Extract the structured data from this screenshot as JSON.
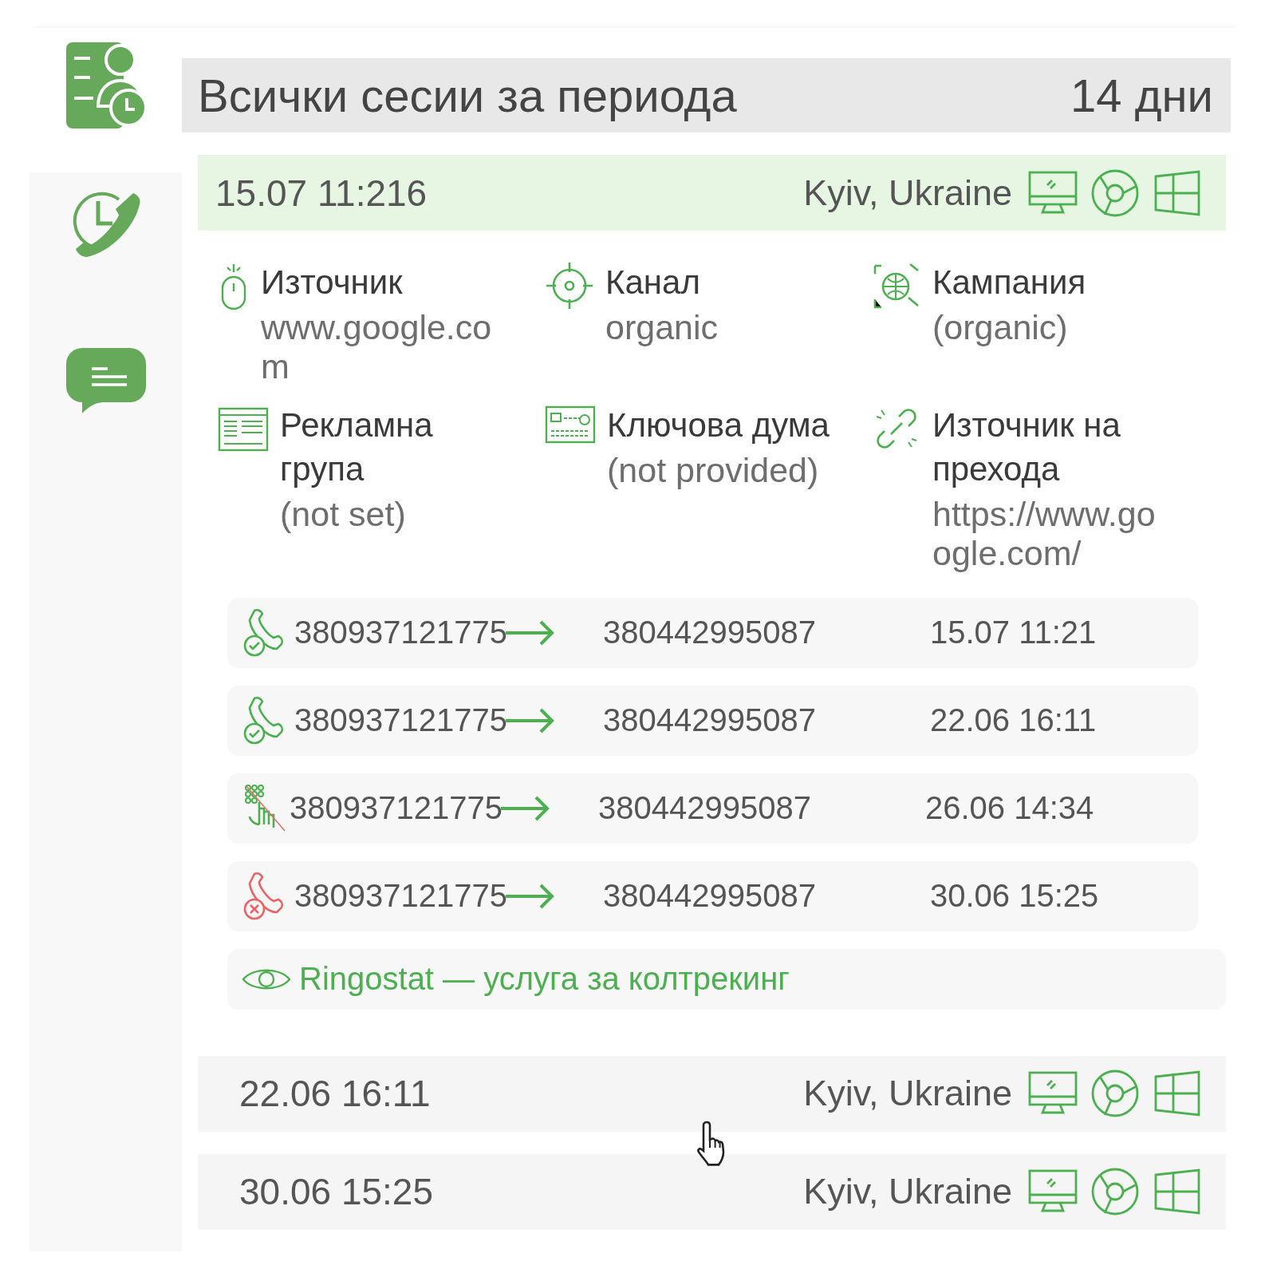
{
  "sidebar": {
    "items": [
      {
        "kind": "sessions",
        "selected": true
      },
      {
        "kind": "calls",
        "selected": false
      },
      {
        "kind": "messages",
        "selected": false
      }
    ]
  },
  "header": {
    "title": "Всички сесии за периода",
    "period": "14 дни"
  },
  "sessions": [
    {
      "datetime": "15.07 11:216",
      "location": "Kyiv, Ukraine",
      "expanded": true,
      "details": [
        {
          "kind": "source",
          "label": "Източник",
          "value": "www.google.com"
        },
        {
          "kind": "channel",
          "label": "Канал",
          "value": "organic"
        },
        {
          "kind": "campaign",
          "label": "Кампания",
          "value": "(organic)"
        },
        {
          "kind": "adgroup",
          "label": "Рекламна група",
          "value": "(not set)"
        },
        {
          "kind": "keyword",
          "label": "Ключова дума",
          "value": "(not provided)"
        },
        {
          "kind": "referrer",
          "label": "Източник на прехода",
          "value": "https://www.google.com/"
        }
      ],
      "calls": [
        {
          "kind": "answered",
          "from": "380937121775",
          "to": "380442995087",
          "datetime": "15.07 11:21"
        },
        {
          "kind": "answered",
          "from": "380937121775",
          "to": "380442995087",
          "datetime": "22.06 16:11"
        },
        {
          "kind": "ivr",
          "from": "380937121775",
          "to": "380442995087",
          "datetime": "26.06 14:34"
        },
        {
          "kind": "missed",
          "from": "380937121775",
          "to": "380442995087",
          "datetime": "30.06  15:25"
        }
      ],
      "link": "Ringostat — услуга за колтрекинг"
    },
    {
      "datetime": "22.06 16:11",
      "location": "Kyiv, Ukraine",
      "expanded": false
    },
    {
      "datetime": "30.06  15:25",
      "location": "Kyiv, Ukraine",
      "expanded": false
    }
  ]
}
